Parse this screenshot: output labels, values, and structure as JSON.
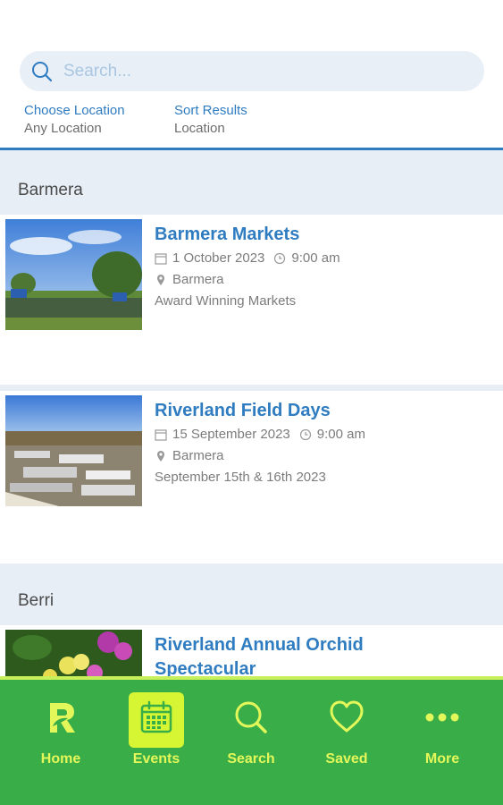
{
  "search": {
    "placeholder": "Search..."
  },
  "filters": {
    "location": {
      "label": "Choose Location",
      "value": "Any Location"
    },
    "sort": {
      "label": "Sort Results",
      "value": "Location"
    }
  },
  "sections": [
    {
      "title": "Barmera",
      "events": [
        {
          "title": "Barmera Markets",
          "date": "1 October 2023",
          "time": "9:00 am",
          "location": "Barmera",
          "description": "Award Winning Markets"
        },
        {
          "title": "Riverland Field Days",
          "date": "15 September 2023",
          "time": "9:00 am",
          "location": "Barmera",
          "description": "September 15th & 16th 2023"
        }
      ]
    },
    {
      "title": "Berri",
      "events": [
        {
          "title": "Riverland Annual Orchid Spectacular"
        }
      ]
    }
  ],
  "nav": {
    "items": [
      {
        "label": "Home",
        "icon": "home-logo-icon"
      },
      {
        "label": "Events",
        "icon": "calendar-icon",
        "active": true
      },
      {
        "label": "Search",
        "icon": "search-icon"
      },
      {
        "label": "Saved",
        "icon": "heart-icon"
      },
      {
        "label": "More",
        "icon": "more-dots-icon"
      }
    ]
  },
  "colors": {
    "accent": "#2f7cc1",
    "nav_bg": "#39ad48",
    "nav_text": "#e4f75a",
    "section_bg": "#e8eef6"
  }
}
